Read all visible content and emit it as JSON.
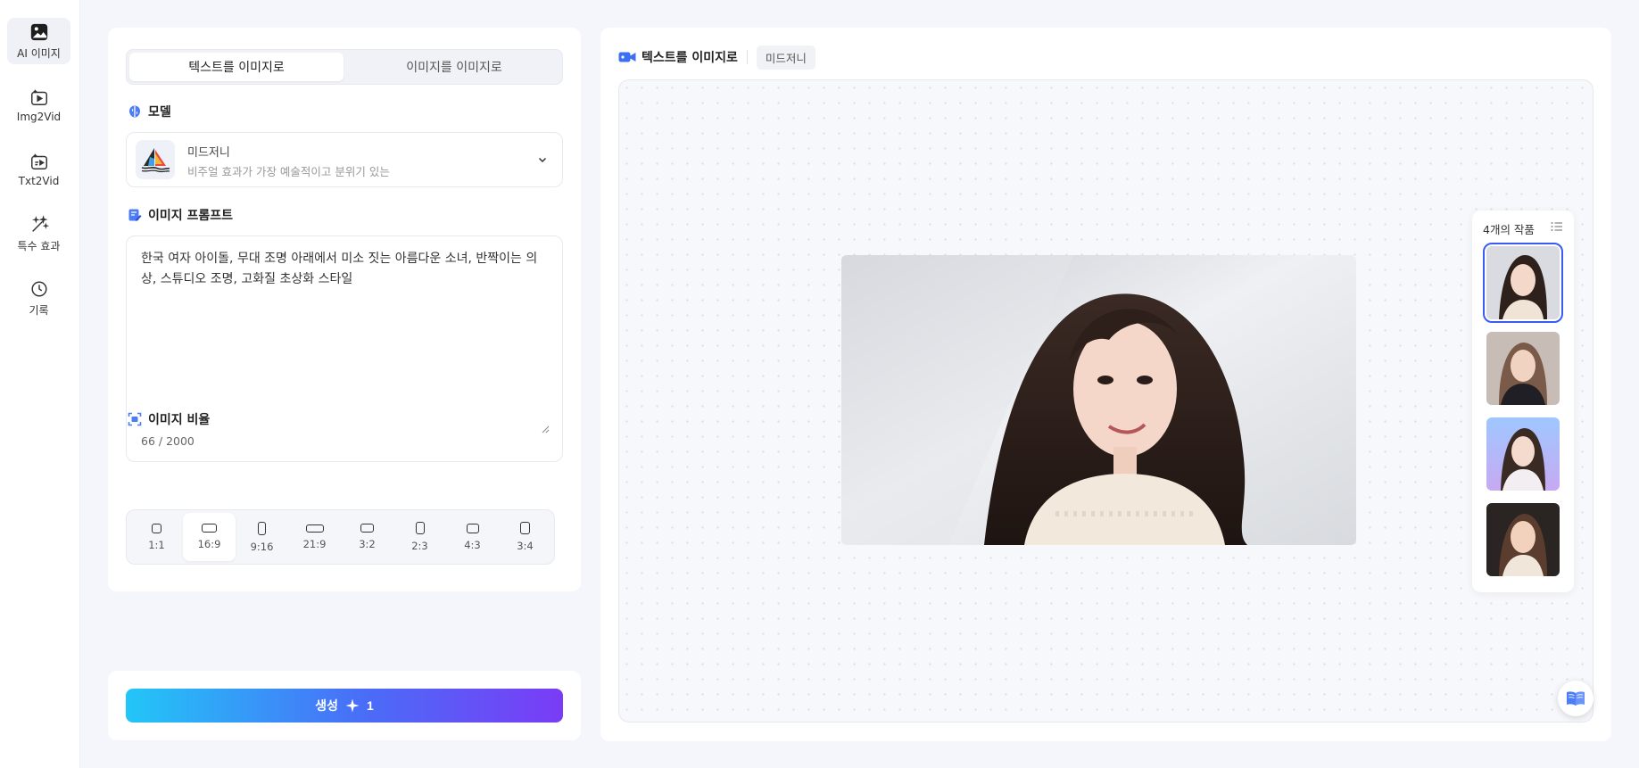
{
  "nav": {
    "items": [
      {
        "label": "AI 이미지",
        "icon": "image-icon",
        "active": true
      },
      {
        "label": "Img2Vid",
        "icon": "image-to-video-icon",
        "active": false
      },
      {
        "label": "Txt2Vid",
        "icon": "text-to-video-icon",
        "active": false
      },
      {
        "label": "특수 효과",
        "icon": "magic-wand-icon",
        "active": false
      },
      {
        "label": "기록",
        "icon": "clock-icon",
        "active": false
      }
    ]
  },
  "left": {
    "tabs": [
      {
        "label": "텍스트를 이미지로",
        "active": true
      },
      {
        "label": "이미지를 이미지로",
        "active": false
      }
    ],
    "model": {
      "section_title": "모델",
      "name": "미드저니",
      "description": "비주얼 효과가 가장 예술적이고 분위기 있는"
    },
    "prompt": {
      "section_title": "이미지 프롬프트",
      "text": "한국 여자 아이돌, 무대 조명 아래에서 미소 짓는 아름다운 소녀, 반짝이는 의상, 스튜디오 조명, 고화질 초상화 스타일",
      "count": "66 / 2000"
    },
    "ratio": {
      "section_title": "이미지 비율",
      "options": [
        "1:1",
        "16:9",
        "9:16",
        "21:9",
        "3:2",
        "2:3",
        "4:3",
        "3:4"
      ],
      "selected": "16:9"
    },
    "generate": {
      "label": "생성",
      "credits": "1"
    }
  },
  "right": {
    "title": "텍스트를 이미지로",
    "model_chip": "미드저니",
    "works": {
      "title": "4개의 작품",
      "count": 4,
      "selected_index": 0
    }
  },
  "colors": {
    "accent": "#3a5cf5",
    "gradient_start": "#22c6f7",
    "gradient_end": "#7a3cf6",
    "page_bg": "#f4f6fb"
  }
}
